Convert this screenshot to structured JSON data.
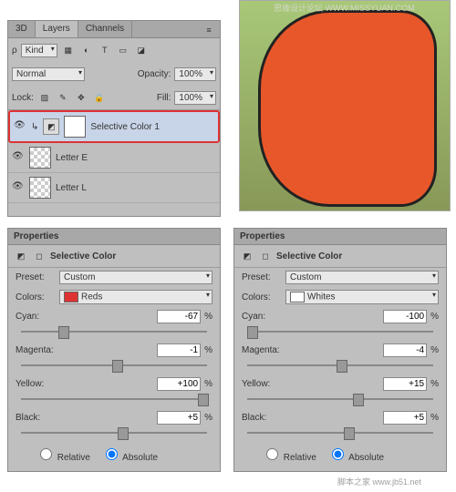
{
  "topWatermark": "思缘设计论坛 WWW.MISSYUAN.COM",
  "layers": {
    "tabs": [
      "3D",
      "Layers",
      "Channels"
    ],
    "kind": "Kind",
    "blend": "Normal",
    "opacityLabel": "Opacity:",
    "opacity": "100%",
    "lockLabel": "Lock:",
    "fillLabel": "Fill:",
    "fill": "100%",
    "items": [
      {
        "name": "Selective Color 1",
        "selected": true
      },
      {
        "name": "Letter E"
      },
      {
        "name": "Letter L"
      }
    ]
  },
  "propsTitle": "Properties",
  "propsSub": "Selective Color",
  "presetLabel": "Preset:",
  "preset": "Custom",
  "colorsLabel": "Colors:",
  "sliders": [
    "Cyan:",
    "Magenta:",
    "Yellow:",
    "Black:"
  ],
  "modes": [
    "Relative",
    "Absolute"
  ],
  "left": {
    "color": "Reds",
    "cyan": "-67",
    "magenta": "-1",
    "yellow": "+100",
    "black": "+5"
  },
  "right": {
    "color": "Whites",
    "cyan": "-100",
    "magenta": "-4",
    "yellow": "+15",
    "black": "+5"
  },
  "pct": "%",
  "footer": "脚本之家 www.jb51.net"
}
